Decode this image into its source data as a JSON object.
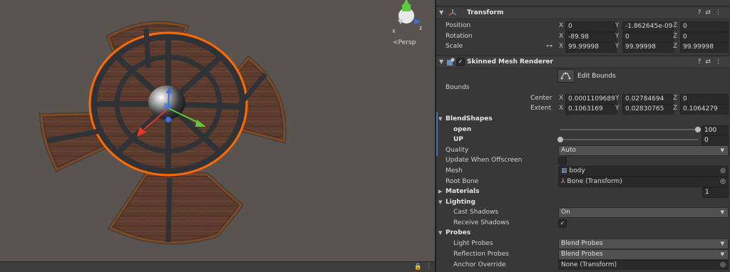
{
  "scene": {
    "persp_label": "<Persp",
    "gizmo_axes": {
      "x": "x",
      "y": "y",
      "z": "z"
    },
    "bottom_icons": {
      "lock": "lock-icon",
      "menu": "menu-icon"
    }
  },
  "transform": {
    "title": "Transform",
    "position": {
      "label": "Position",
      "x": "0",
      "y": "-1.862645e-09",
      "z": "0"
    },
    "rotation": {
      "label": "Rotation",
      "x": "-89.98",
      "y": "0",
      "z": "0"
    },
    "scale": {
      "label": "Scale",
      "x": "99.99998",
      "y": "99.99998",
      "z": "99.99998"
    }
  },
  "axes": {
    "x": "X",
    "y": "Y",
    "z": "Z"
  },
  "skinned": {
    "title": "Skinned Mesh Renderer",
    "edit_bounds": "Edit Bounds",
    "bounds_label": "Bounds",
    "center": {
      "label": "Center",
      "x": "0.0001109689",
      "y": "0.02784694",
      "z": "0"
    },
    "extent": {
      "label": "Extent",
      "x": "0.1063169",
      "y": "0.02830765",
      "z": "0.1064279"
    },
    "blendshapes": {
      "label": "BlendShapes",
      "open": {
        "label": "open",
        "value": "100",
        "fraction": 1.0
      },
      "up": {
        "label": "UP",
        "value": "0",
        "fraction": 0.0
      }
    },
    "quality": {
      "label": "Quality",
      "value": "Auto"
    },
    "update_offscreen": {
      "label": "Update When Offscreen",
      "checked": false
    },
    "mesh": {
      "label": "Mesh",
      "value": "body"
    },
    "root_bone": {
      "label": "Root Bone",
      "value": "Bone (Transform)"
    },
    "materials": {
      "label": "Materials",
      "count": "1"
    },
    "lighting": {
      "label": "Lighting",
      "cast_shadows": {
        "label": "Cast Shadows",
        "value": "On"
      },
      "receive_shadows": {
        "label": "Receive Shadows",
        "checked": true
      }
    },
    "probes": {
      "label": "Probes",
      "light_probes": {
        "label": "Light Probes",
        "value": "Blend Probes"
      },
      "reflection_probes": {
        "label": "Reflection Probes",
        "value": "Blend Probes"
      },
      "anchor_override": {
        "label": "Anchor Override",
        "value": "None (Transform)"
      }
    }
  },
  "header_icons": [
    "help-icon",
    "preset-icon",
    "more-icon"
  ],
  "colors": {
    "selection_outline": "#ff6a00",
    "x_axis": "#e03a2a",
    "y_axis": "#5ccc3c",
    "z_axis": "#3a6fe0",
    "wood": "#5a3a2c"
  }
}
